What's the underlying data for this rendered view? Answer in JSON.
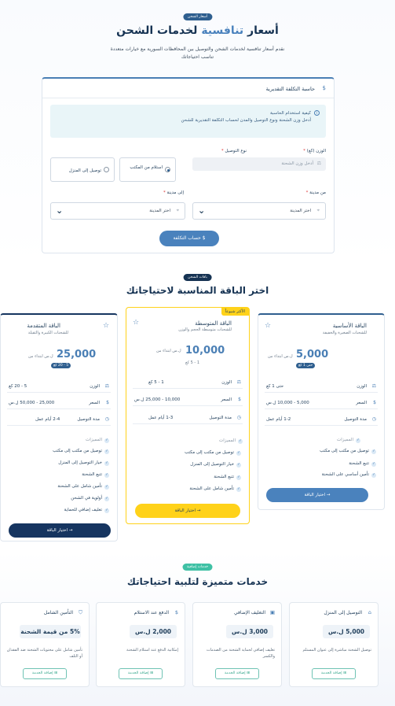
{
  "hero": {
    "badge": "أسعار الشحن",
    "title_prefix": "أسعار",
    "title_accent": "تنافسية",
    "title_suffix": "لخدمات الشحن",
    "subtitle_line1": "نقدم أسعار تنافسية لخدمات الشحن والتوصيل بين المحافظات السورية مع خيارات متعددة",
    "subtitle_line2": "تناسب احتياجاتك"
  },
  "calculator": {
    "title": "حاسبة التكلفة التقديرية",
    "info_title": "كيفية استخدام الحاسبة",
    "info_desc": "أدخل وزن الشحنة ونوع التوصيل والمدن لحساب التكلفة التقديرية للشحن",
    "weight_label": "الوزن (كغ)",
    "weight_placeholder": "أدخل وزن الشحنة",
    "delivery_label": "نوع التوصيل",
    "option_pickup": "استلام من المكتب",
    "option_home": "توصيل إلى المنزل",
    "from_label": "من مدينة",
    "to_label": "إلى مدينة",
    "city_placeholder": "اختر المدينة",
    "required_mark": "*",
    "button": "حساب التكلفة"
  },
  "plans_section": {
    "badge": "باقات الشحن",
    "title": "اختر الباقة المناسبة لاحتياجاتك",
    "features_heading": "المميزات",
    "from_text": "ابتداء من",
    "keys": {
      "weight": "الوزن",
      "price": "السعر",
      "duration": "مدة التوصيل"
    }
  },
  "plans": [
    {
      "name": "الباقة الأساسية",
      "desc": "للشحنات الصغيرة والخفيفة",
      "price": "5,000",
      "currency": "ل.س",
      "weight_badge": "حتى 1 كغ",
      "weight": "حتى 1 كغ",
      "price_range": "5,000 - 10,000 ل.س",
      "duration": "1-2 أيام عمل",
      "features": [
        "توصيل من مكتب إلى مكتب",
        "تتبع الشحنة",
        "تأمين أساسي على الشحنة"
      ],
      "button": "اختيار الباقة"
    },
    {
      "name": "الباقة المتوسطة",
      "desc": "للشحنات متوسطة الحجم والوزن",
      "price": "10,000",
      "currency": "ل.س",
      "weight_badge": "1 - 5 كغ",
      "popular": "الأكثر شيوعاً",
      "weight": "1 - 5 كغ",
      "price_range": "10,000 - 25,000 ل.س",
      "duration": "1-3 أيام عمل",
      "features": [
        "توصيل من مكتب إلى مكتب",
        "خيار التوصيل إلى المنزل",
        "تتبع الشحنة",
        "تأمين شامل على الشحنة"
      ],
      "button": "اختيار الباقة"
    },
    {
      "name": "الباقة المتقدمة",
      "desc": "للشحنات الكبيرة والثقيلة",
      "price": "25,000",
      "currency": "ل.س",
      "weight_badge": "5 - 20 كغ",
      "weight": "5 - 20 كغ",
      "price_range": "25,000 - 50,000 ل.س",
      "duration": "2-4 أيام عمل",
      "features": [
        "توصيل من مكتب إلى مكتب",
        "خيار التوصيل إلى المنزل",
        "تتبع الشحنة",
        "تأمين شامل على الشحنة",
        "أولوية في الشحن",
        "تغليف إضافي للحماية"
      ],
      "button": "اختيار الباقة"
    }
  ],
  "services_section": {
    "badge": "خدمات إضافية",
    "title": "خدمات متميزة لتلبية احتياجاتك"
  },
  "services": [
    {
      "title": "التوصيل إلى المنزل",
      "price": "5,000 ل.س",
      "desc": "توصيل الشحنة مباشرة إلى عنوان المستلم",
      "button": "إضافة الخدمة"
    },
    {
      "title": "التغليف الإضافي",
      "price": "3,000 ل.س",
      "desc": "تغليف إضافي لحماية الشحنة من الصدمات والكسر",
      "button": "إضافة الخدمة"
    },
    {
      "title": "الدفع عند الاستلام",
      "price": "2,000 ل.س",
      "desc": "إمكانية الدفع عند استلام الشحنة",
      "button": "إضافة الخدمة"
    },
    {
      "title": "التأمين الشامل",
      "price": "5% من قيمة الشحنة",
      "desc": "تأمين شامل على محتويات الشحنة ضد الفقدان أو التلف",
      "button": "إضافة الخدمة"
    }
  ],
  "colors": {
    "primary": "#2f5f8f",
    "accent": "#4a82bd",
    "popular": "#ffd21a",
    "teal": "#3fc1a5",
    "dark_button": "#163560"
  }
}
